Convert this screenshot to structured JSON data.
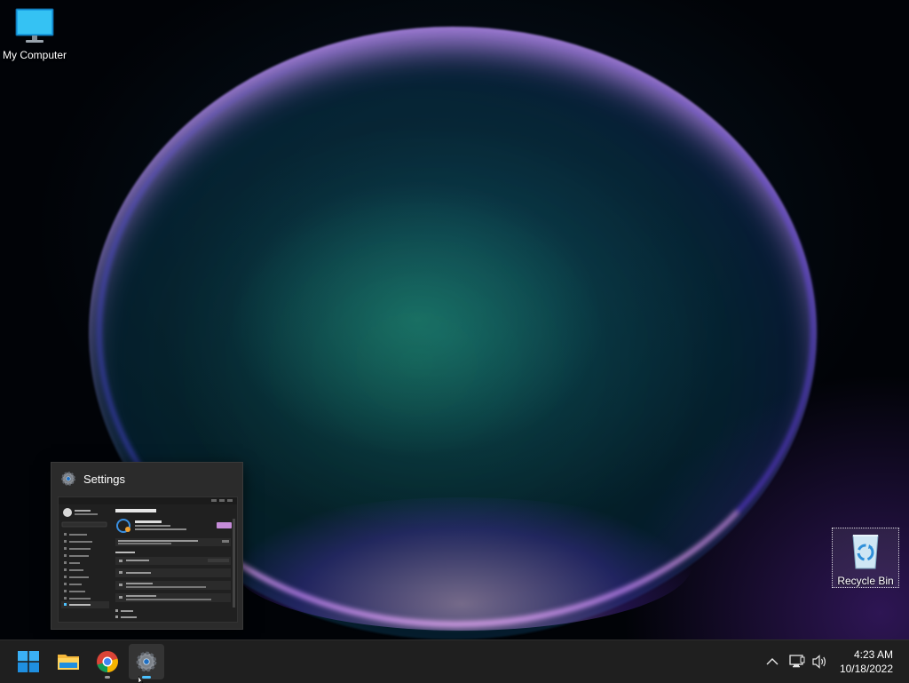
{
  "desktop": {
    "icons": [
      {
        "label": "My Computer",
        "icon": "monitor-icon"
      },
      {
        "label": "Recycle Bin",
        "icon": "recycle-bin-icon"
      }
    ]
  },
  "thumbnail": {
    "title": "Settings",
    "icon": "gear-icon"
  },
  "taskbar": {
    "apps": [
      {
        "name": "Start",
        "icon": "windows-logo-icon"
      },
      {
        "name": "File Explorer",
        "icon": "folder-icon"
      },
      {
        "name": "Google Chrome",
        "icon": "chrome-icon"
      },
      {
        "name": "Settings",
        "icon": "gear-icon",
        "active": true
      }
    ],
    "tray": {
      "icons": [
        "chevron-up-icon",
        "network-icon",
        "volume-icon"
      ],
      "time": "4:23 AM",
      "date": "10/18/2022"
    }
  },
  "colors": {
    "accent": "#4cc2ff",
    "taskbar_bg": "#1f1f1f",
    "settings_pink": "#c58bd8"
  }
}
